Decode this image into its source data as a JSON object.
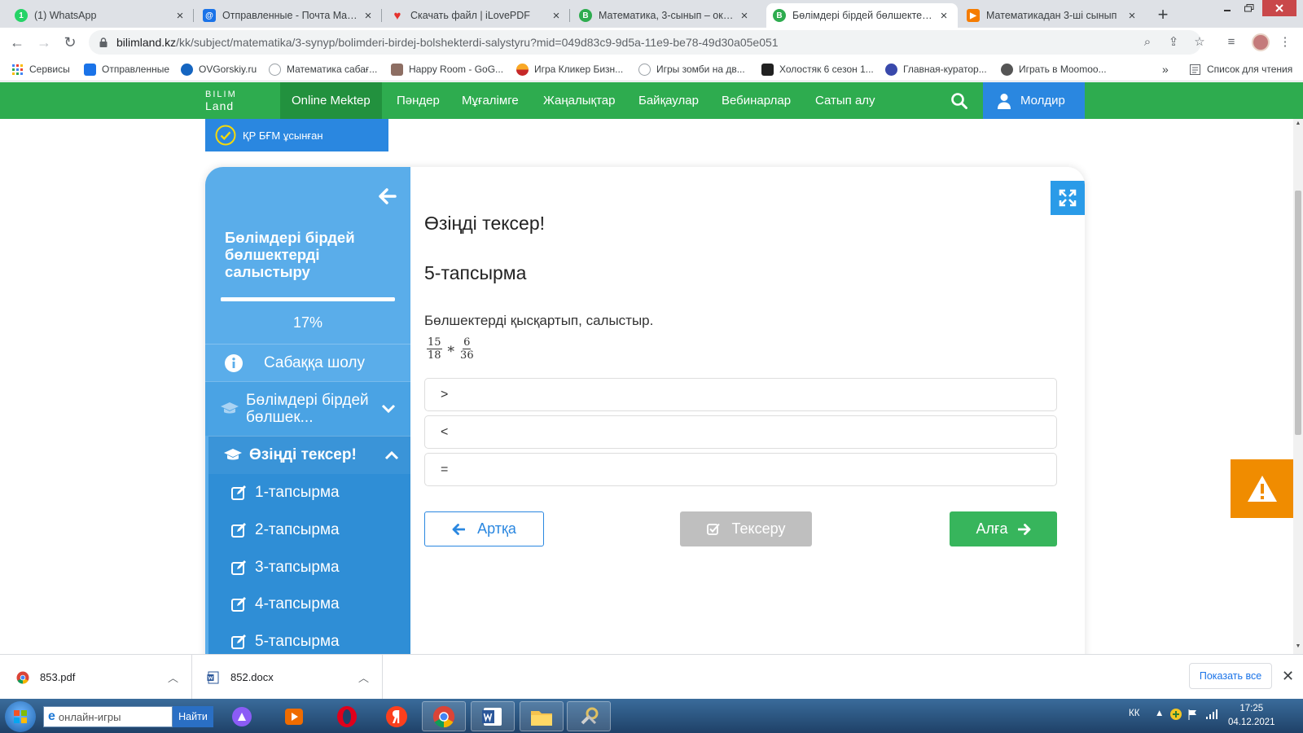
{
  "browser": {
    "tabs": [
      {
        "title": "(1) WhatsApp",
        "color": "#25d366",
        "glyph": "1"
      },
      {
        "title": "Отправленные - Почта Mail.ru",
        "color": "#1a73e8",
        "glyph": "@"
      },
      {
        "title": "Скачать файл | iLovePDF",
        "color": "#e5322d",
        "glyph": "♥"
      },
      {
        "title": "Математика, 3-сынып – окушы",
        "color": "#2eac4f",
        "glyph": "B"
      },
      {
        "title": "Бөлімдері бірдей бөлшектерд",
        "color": "#2eac4f",
        "glyph": "B"
      },
      {
        "title": "Математикадан 3-ші сынып",
        "color": "#f57c00",
        "glyph": "▶"
      }
    ],
    "new_tab": "+",
    "url_host": "bilimland.kz",
    "url_path": "/kk/subject/matematika/3-synyp/bolimderi-birdej-bolshekterdi-salystyru?mid=049d83c9-9d5a-11e9-be78-49d30a05e051",
    "bookmarks": [
      {
        "label": "Сервисы",
        "color": "#4285f4"
      },
      {
        "label": "Отправленные",
        "color": "#1a73e8"
      },
      {
        "label": "OVGorskiy.ru",
        "color": "#1565c0"
      },
      {
        "label": "Математика сабағ...",
        "color": "#9aa0a6"
      },
      {
        "label": "Happy Room - GoG...",
        "color": "#8d6e63"
      },
      {
        "label": "Игра Кликер Бизн...",
        "color": "#f9a825"
      },
      {
        "label": "Игры зомби на дв...",
        "color": "#9aa0a6"
      },
      {
        "label": "Холостяк 6 сезон 1...",
        "color": "#212121"
      },
      {
        "label": "Главная-куратор...",
        "color": "#3949ab"
      },
      {
        "label": "Играть в Moomoo...",
        "color": "#555555"
      }
    ],
    "bookmarks_more": "»",
    "reading_list": "Список для чтения"
  },
  "site": {
    "logo_top": "BILIM",
    "logo_bottom": "Land",
    "nav": [
      "Online Mektep",
      "Пәндер",
      "Мұғалімге",
      "Жаңалықтар",
      "Байқаулар",
      "Вебинарлар",
      "Сатып алу"
    ],
    "user": "Молдир",
    "badge": "ҚР БҒМ ұсынған",
    "brand_green": "#2eac4f",
    "brand_blue": "#2a87e0"
  },
  "sidebar": {
    "title": "Бөлімдері бірдей бөлшектерді салыстыру",
    "progress_fraction": 0.17,
    "progress_text": "17%",
    "overview": "Сабаққа шолу",
    "section1": "Бөлімдері бірдей бөлшек...",
    "section2": "Өзіңді тексер!",
    "tasks": [
      "1-тапсырма",
      "2-тапсырма",
      "3-тапсырма",
      "4-тапсырма",
      "5-тапсырма"
    ]
  },
  "content": {
    "heading": "Өзіңді тексер!",
    "task_title": "5-тапсырма",
    "question": "Бөлшектерді қысқартып, салыстыр.",
    "fraction_a": {
      "num": "15",
      "den": "18"
    },
    "operator": "*",
    "fraction_b": {
      "num": "6",
      "den": "36"
    },
    "options": [
      ">",
      "<",
      "="
    ],
    "back_label": "Артқа",
    "check_label": "Тексеру",
    "next_label": "Алға"
  },
  "downloads": {
    "items": [
      "853.pdf",
      "852.docx"
    ],
    "show_all": "Показать все",
    "close": "✕"
  },
  "taskbar": {
    "search_placeholder": "онлайн-игры",
    "search_button": "Найти",
    "lang": "КК",
    "time": "17:25",
    "date": "04.12.2021"
  }
}
